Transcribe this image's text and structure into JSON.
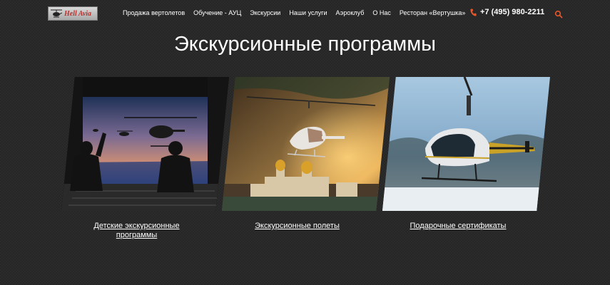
{
  "header": {
    "logo_text": "Hell Avia",
    "nav": [
      "Продажа вертолетов",
      "Обучение - АУЦ",
      "Экскурсии",
      "Наши услуги",
      "Аэроклуб",
      "О Нас",
      "Ресторан «Вертушка»"
    ],
    "phone": "+7 (495) 980-2211"
  },
  "page": {
    "title": "Экскурсионные программы"
  },
  "cards": [
    {
      "link_line1": "Детские экскурсионные",
      "link_line2": "программы"
    },
    {
      "link": "Экскурсионные полеты"
    },
    {
      "link": "Подарочные сертификаты"
    }
  ],
  "colors": {
    "background": "#262626",
    "accent": "#e8572a",
    "text": "#ffffff"
  },
  "icons": {
    "phone": "phone-icon",
    "search": "search-icon",
    "logo": "helicopter-logo-icon"
  }
}
